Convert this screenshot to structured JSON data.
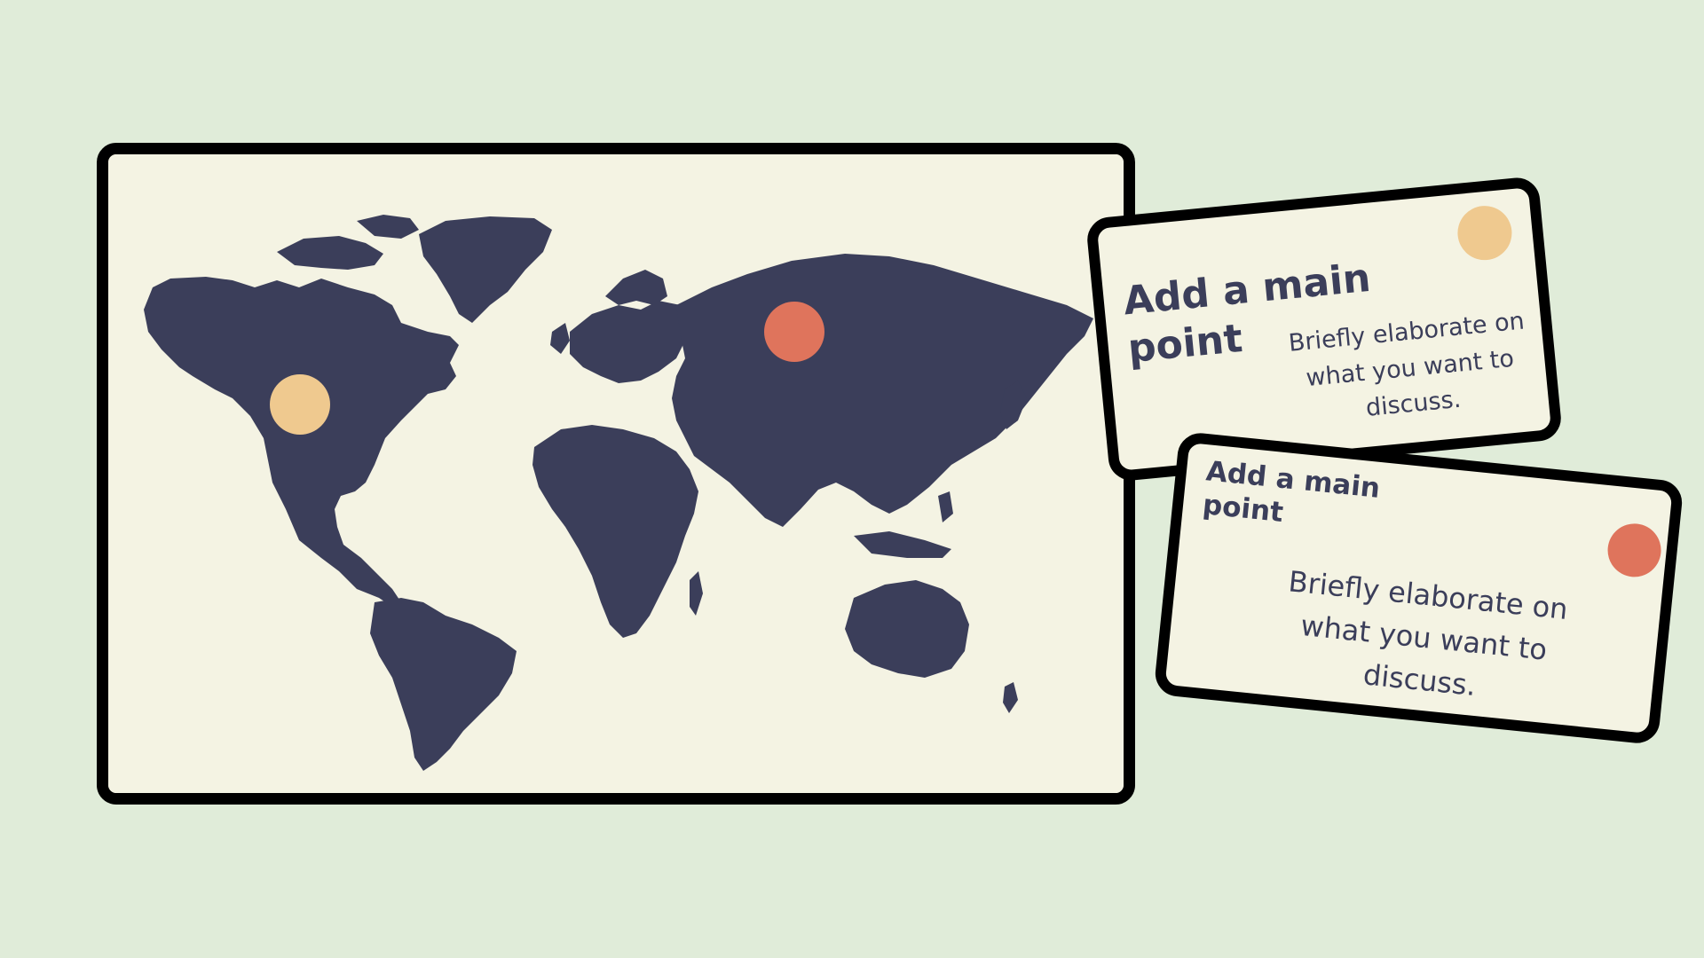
{
  "colors": {
    "background": "#e0ecd9",
    "panel": "#f4f3e3",
    "land": "#3b3e5a",
    "border": "#000000",
    "text": "#3b3e5a",
    "yellow_marker": "#efc98f",
    "coral_marker": "#df745c"
  },
  "map": {
    "markers": [
      {
        "name": "north-america-marker",
        "color": "#efc98f"
      },
      {
        "name": "russia-marker",
        "color": "#df745c"
      }
    ]
  },
  "cards": [
    {
      "title": "Add a main point",
      "body": "Briefly elaborate on what you want to discuss.",
      "dot_color": "#efc98f"
    },
    {
      "title": "Add a main point",
      "body": "Briefly elaborate on what you want to discuss.",
      "dot_color": "#df745c"
    }
  ]
}
